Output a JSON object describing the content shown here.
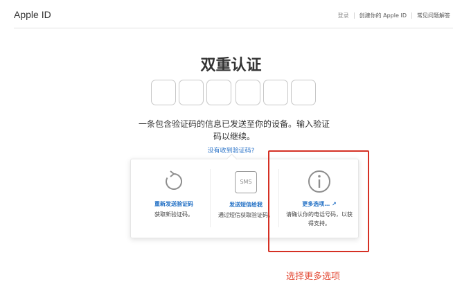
{
  "header": {
    "brand": "Apple ID",
    "nav": [
      "登录",
      "创建你的 Apple ID",
      "常见问题解答"
    ]
  },
  "main": {
    "title": "双重认证",
    "message": "一条包含验证码的信息已发送至你的设备。输入验证码以继续。",
    "no_code_link": "没有收到验证码?"
  },
  "options": [
    {
      "icon": "refresh-icon",
      "title": "重新发送验证码",
      "desc": "获取新验证码。"
    },
    {
      "icon": "sms-icon",
      "icon_text": "SMS",
      "title": "发送短信给我",
      "desc": "通过短信获取验证码。"
    },
    {
      "icon": "info-icon",
      "title": "更多选项…",
      "desc": "请确认你的电话号码，以获得支持。"
    }
  ],
  "annotation": {
    "caption": "选择更多选项",
    "color": "#d53024"
  },
  "colors": {
    "link": "#2e75c9",
    "option_title": "#1f6ec4"
  }
}
